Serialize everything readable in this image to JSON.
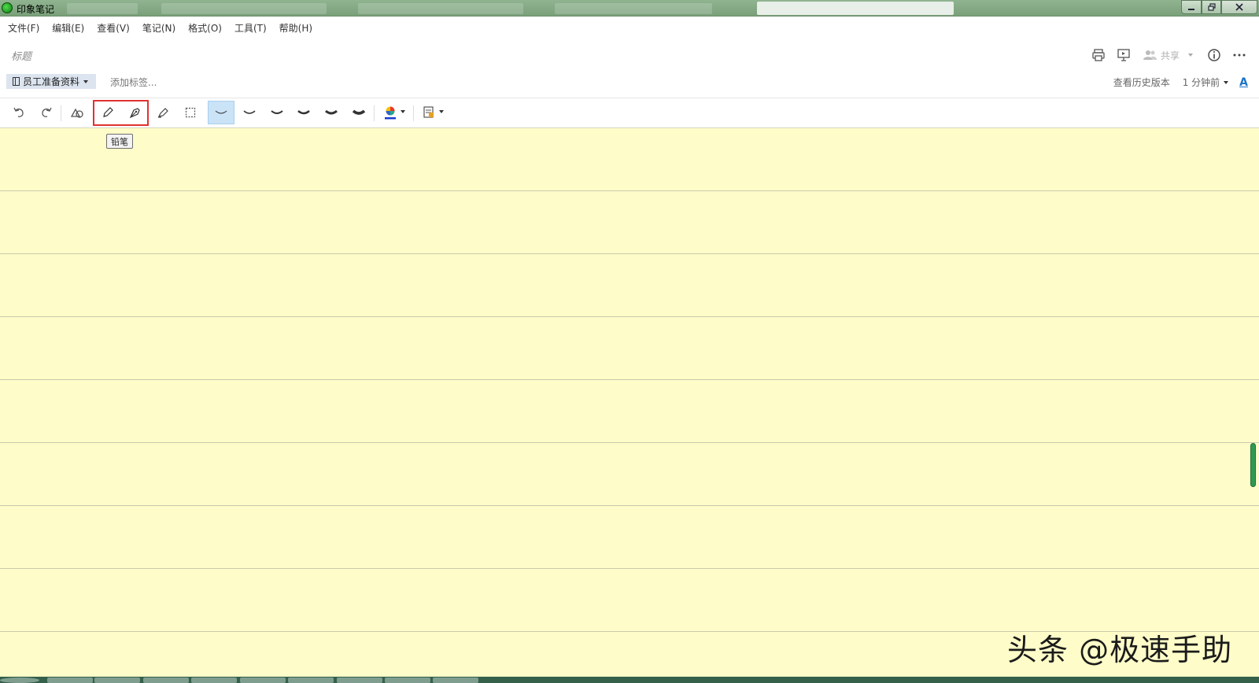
{
  "window": {
    "title": "印象笔记"
  },
  "menu": [
    "文件(F)",
    "编辑(E)",
    "查看(V)",
    "笔记(N)",
    "格式(O)",
    "工具(T)",
    "帮助(H)"
  ],
  "note": {
    "title_placeholder": "标题",
    "share_label": "共享"
  },
  "tags": {
    "notebook": "员工准备资料",
    "add_tag": "添加标签...",
    "history": "查看历史版本",
    "updated": "1 分钟前",
    "font_label": "A"
  },
  "toolbar": {
    "tooltip": "铅笔",
    "tools": [
      "undo-icon",
      "redo-icon",
      "shapes-icon",
      "pencil-icon",
      "pen-icon",
      "highlighter-icon",
      "lasso-select-icon"
    ],
    "stroke_widths": 6,
    "selected_stroke": 0,
    "accent_color": "#e03232",
    "ink_color": "#1a3bd1"
  },
  "canvas": {
    "background": "#fefdc9"
  },
  "watermark": "头条 @极速手助"
}
